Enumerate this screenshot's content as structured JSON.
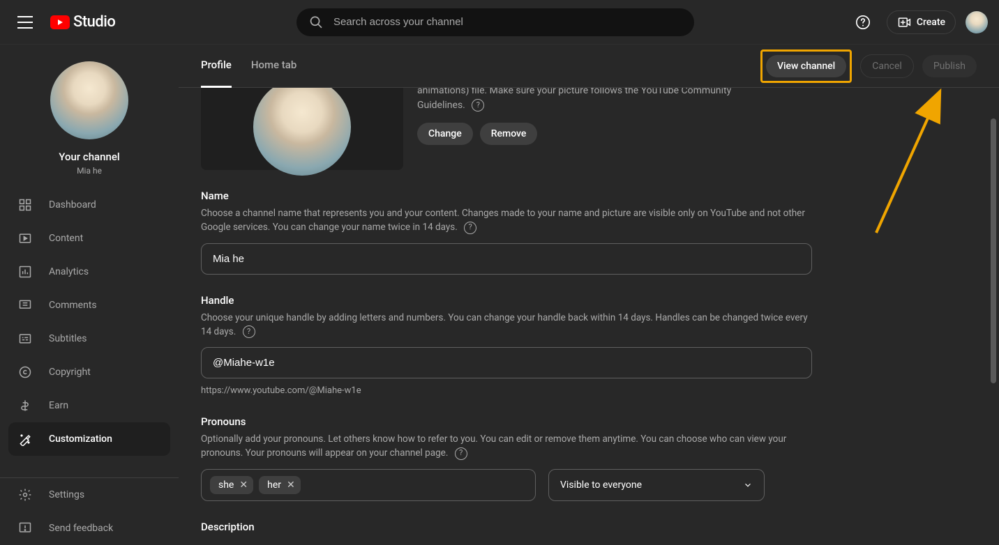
{
  "header": {
    "logo_text": "Studio",
    "search_placeholder": "Search across your channel",
    "create_label": "Create"
  },
  "sidebar": {
    "channel_label": "Your channel",
    "channel_name": "Mia he",
    "nav": {
      "dashboard": "Dashboard",
      "content": "Content",
      "analytics": "Analytics",
      "comments": "Comments",
      "subtitles": "Subtitles",
      "copyright": "Copyright",
      "earn": "Earn",
      "customization": "Customization",
      "settings": "Settings",
      "feedback": "Send feedback"
    }
  },
  "tabs": {
    "profile": "Profile",
    "home": "Home tab"
  },
  "actions": {
    "view_channel": "View channel",
    "cancel": "Cancel",
    "publish": "Publish"
  },
  "picture": {
    "desc_partial": "animations) file. Make sure your picture follows the YouTube Community Guidelines.",
    "change": "Change",
    "remove": "Remove"
  },
  "name_section": {
    "title": "Name",
    "desc": "Choose a channel name that represents you and your content. Changes made to your name and picture are visible only on YouTube and not other Google services. You can change your name twice in 14 days.",
    "value": "Mia he"
  },
  "handle_section": {
    "title": "Handle",
    "desc": "Choose your unique handle by adding letters and numbers. You can change your handle back within 14 days. Handles can be changed twice every 14 days.",
    "value": "@Miahe-w1e",
    "url": "https://www.youtube.com/@Miahe-w1e"
  },
  "pronouns_section": {
    "title": "Pronouns",
    "desc": "Optionally add your pronouns. Let others know how to refer to you. You can edit or remove them anytime. You can choose who can view your pronouns. Your pronouns will appear on your channel page.",
    "chips": [
      "she",
      "her"
    ],
    "visibility": "Visible to everyone"
  },
  "description_section": {
    "title": "Description"
  }
}
